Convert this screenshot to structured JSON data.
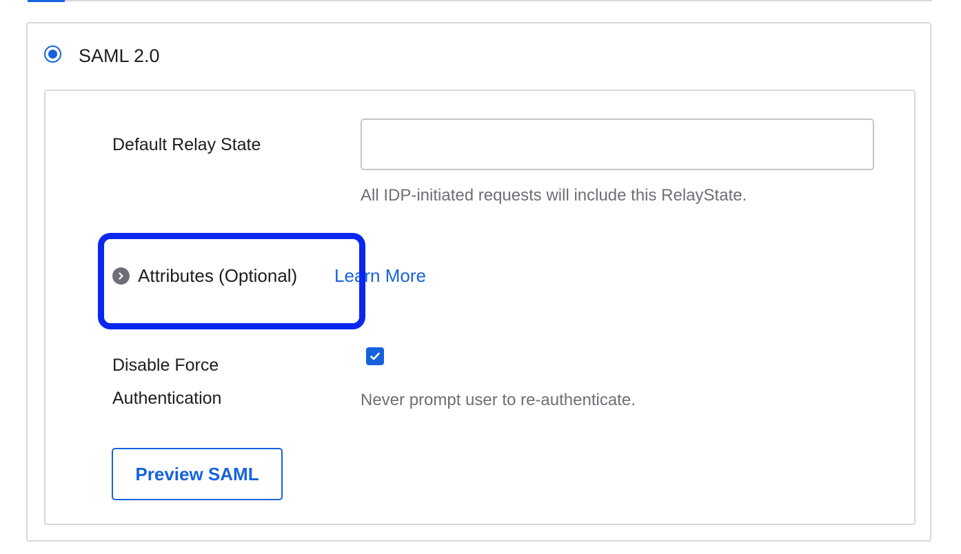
{
  "protocol": {
    "label": "SAML 2.0",
    "selected": true
  },
  "relay_state": {
    "label": "Default Relay State",
    "value": "",
    "placeholder": "",
    "hint": "All IDP-initiated requests will include this RelayState."
  },
  "attributes": {
    "label": "Attributes (Optional)",
    "learn_more": "Learn More",
    "toggle_icon": "chevron-right-icon"
  },
  "force_auth": {
    "label_line1": "Disable Force",
    "label_line2": "Authentication",
    "checked": true,
    "hint": "Never prompt user to re-authenticate."
  },
  "actions": {
    "preview_label": "Preview SAML"
  },
  "colors": {
    "accent": "#1662dd",
    "highlight": "#0a27f0",
    "border": "#d7d7dc",
    "muted_text": "#6e6e78"
  }
}
